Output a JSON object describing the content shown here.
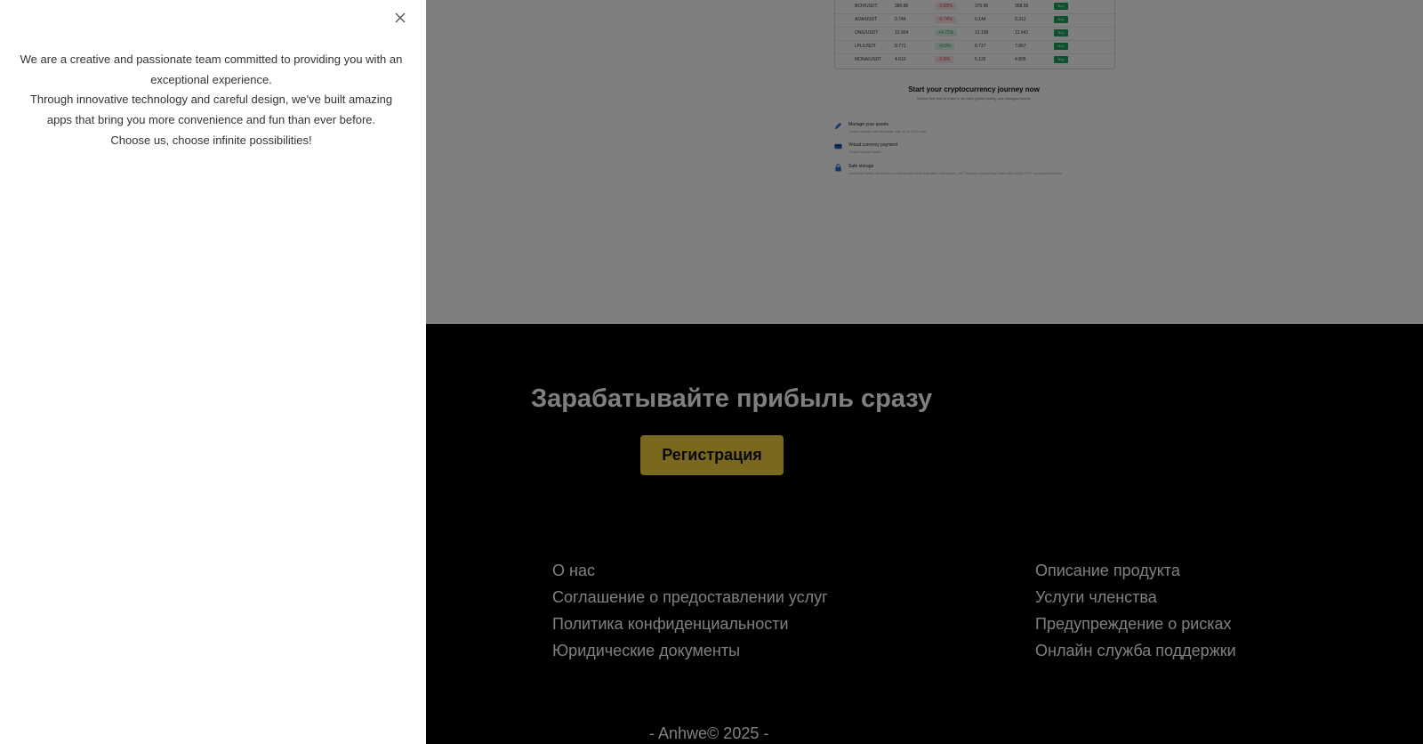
{
  "drawer": {
    "lines": [
      "We are a creative and passionate team committed to providing you with an exceptional experience.",
      "Through innovative technology and careful design, we've built amazing apps that bring you more convenience and fun than ever before.",
      "Choose us, choose infinite possibilities!"
    ]
  },
  "crypto_rows": [
    {
      "pair": "BCH/USDT",
      "price": "380.86",
      "change": "-0.83%",
      "trend": "neg",
      "high": "375.86",
      "low": "358.55",
      "action": "Buy"
    },
    {
      "pair": "ADA/USDT",
      "price": "0.744",
      "change": "-0.74%",
      "trend": "neg",
      "high": "0.144",
      "low": "0.312",
      "action": "Buy"
    },
    {
      "pair": "ONG/USDT",
      "price": "12.954",
      "change": "+0.72%",
      "trend": "pos",
      "high": "12.199",
      "low": "12.641",
      "action": "Buy"
    },
    {
      "pair": "LPL/USDT",
      "price": "8.771",
      "change": "+0.8%",
      "trend": "pos",
      "high": "8.727",
      "low": "7.867",
      "action": "Buy"
    },
    {
      "pair": "MONA/USDT",
      "price": "4.610",
      "change": "-0.8%",
      "trend": "neg",
      "high": "5.125",
      "low": "4.805",
      "action": "Buy"
    }
  ],
  "journey": {
    "title": "Start your cryptocurrency journey now",
    "subtitle": "Money-free flow to make it, we have global trading and managed assets"
  },
  "features": [
    {
      "icon": "pencil-icon",
      "title": "Manage your assets",
      "desc": "Trade instantly with leverage with up to 100x user"
    },
    {
      "icon": "card-icon",
      "title": "Virtual currency payment",
      "desc": "Trade through labels"
    },
    {
      "icon": "lock-icon",
      "title": "Safe storage",
      "desc": "Customer funds are stored in a dedicated multi-signature cold wallet, 24/7 security monitoring, trade with 1000X BTC security protection"
    }
  ],
  "footer": {
    "cta_title": "Зарабатывайте прибыль сразу",
    "register_label": "Регистрация",
    "links_left": [
      "О нас",
      "Соглашение о предоставлении услуг",
      "Политика конфиденциальности",
      "Юридические документы"
    ],
    "links_right": [
      "Описание продукта",
      "Услуги членства",
      "Предупреждение о рисках",
      "Онлайн служба поддержки"
    ],
    "copyright": "- Anhwe© 2025 -"
  },
  "colors": {
    "accent": "#f4d03f",
    "buy": "#1aa05a",
    "positive": "#1aa260",
    "negative": "#e04545"
  }
}
